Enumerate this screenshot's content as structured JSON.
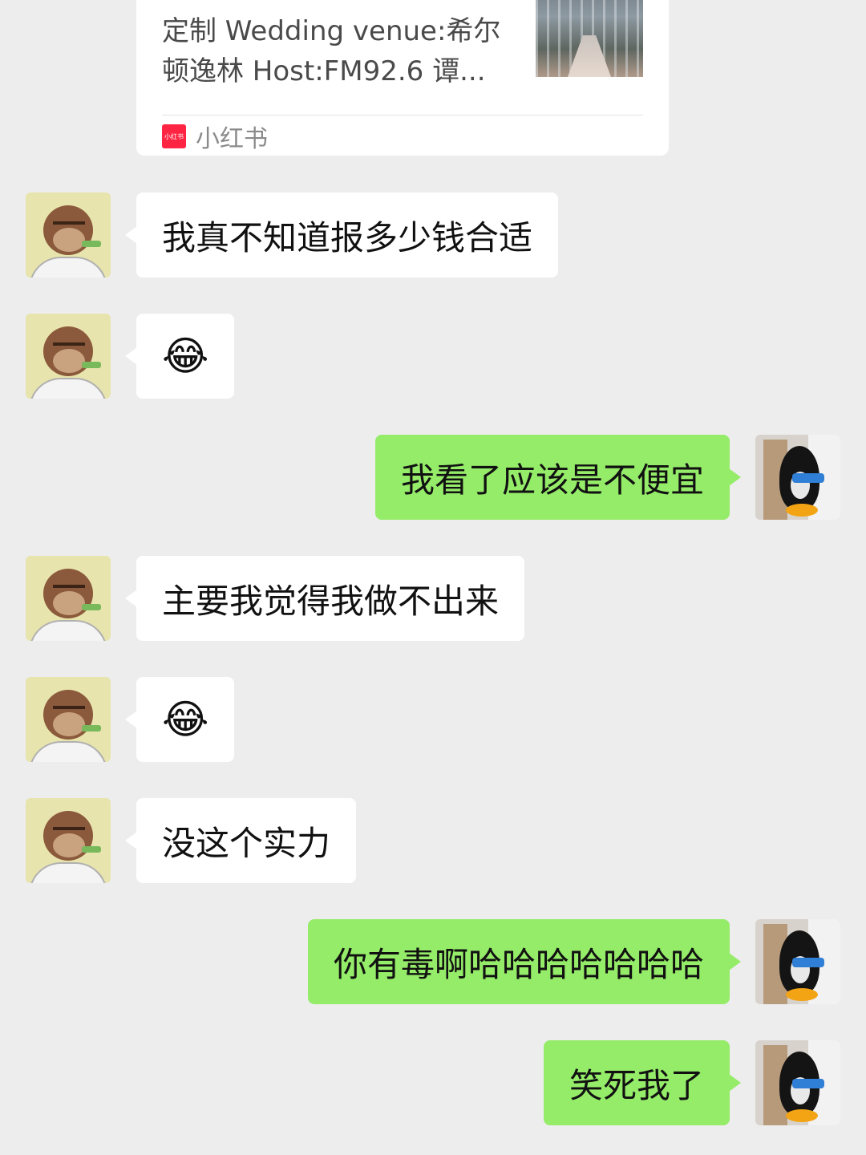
{
  "shared_card": {
    "line1": "定制 Wedding venue:希尔",
    "line2": "顿逸林 Host:FM92.6 谭...",
    "source_label": "小红书",
    "logo_text": "小红书"
  },
  "messages": [
    {
      "sender": "other",
      "text": "我真不知道报多少钱合适"
    },
    {
      "sender": "other",
      "text": "😂"
    },
    {
      "sender": "me",
      "text": "我看了应该是不便宜"
    },
    {
      "sender": "other",
      "text": "主要我觉得我做不出来"
    },
    {
      "sender": "other",
      "text": "😂"
    },
    {
      "sender": "other",
      "text": "没这个实力"
    },
    {
      "sender": "me",
      "text": "你有毒啊哈哈哈哈哈哈哈"
    },
    {
      "sender": "me",
      "text": "笑死我了"
    }
  ],
  "colors": {
    "background": "#ededed",
    "incoming_bubble": "#ffffff",
    "outgoing_bubble": "#95ec69",
    "xiaohongshu_red": "#ff2442"
  }
}
